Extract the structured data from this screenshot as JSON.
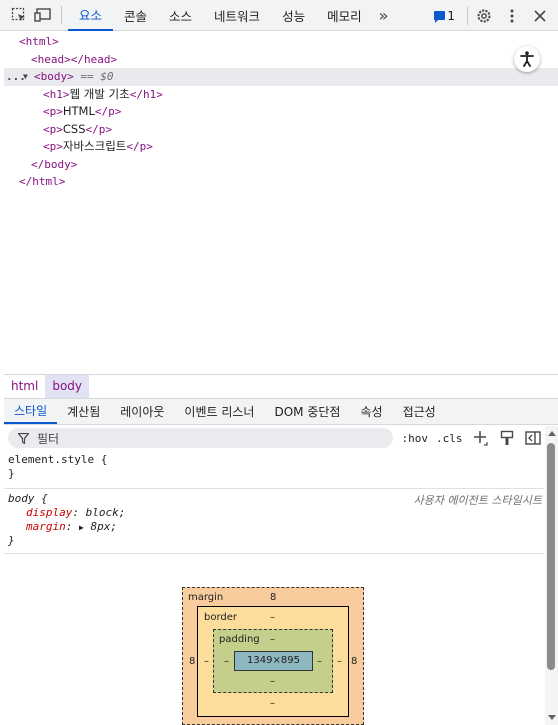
{
  "toolbar": {
    "tabs": [
      "요소",
      "콘솔",
      "소스",
      "네트워크",
      "성능",
      "메모리"
    ],
    "more": "»",
    "issues_count": "1"
  },
  "dom": {
    "lines": [
      {
        "open": "<html>"
      },
      {
        "open": "<head></head>"
      },
      {
        "open": "<body>",
        "eq": " == $0"
      },
      {
        "open": "<h1>",
        "text": "웹 개발 기초",
        "close": "</h1>"
      },
      {
        "open": "<p>",
        "text": "HTML",
        "close": "</p>"
      },
      {
        "open": "<p>",
        "text": "CSS",
        "close": "</p>"
      },
      {
        "open": "<p>",
        "text": "자바스크립트",
        "close": "</p>"
      },
      {
        "open": "</body>"
      },
      {
        "open": "</html>"
      }
    ],
    "dots": "..."
  },
  "breadcrumb": [
    "html",
    "body"
  ],
  "styles_tabs": [
    "스타일",
    "계산됨",
    "레이아웃",
    "이벤트 리스너",
    "DOM 중단점",
    "속성",
    "접근성"
  ],
  "filter": {
    "placeholder": "필터",
    "hov": ":hov",
    "cls": ".cls"
  },
  "rules": {
    "element_style": {
      "selector": "element.style {",
      "close": "}"
    },
    "body": {
      "selector": "body {",
      "source": "사용자 에이전트 스타일시트",
      "p1_name": "display",
      "p1_value": "block;",
      "p2_name": "margin",
      "p2_value": "8px;",
      "close": "}"
    }
  },
  "box_model": {
    "margin_label": "margin",
    "margin_top": "8",
    "margin_left": "8",
    "margin_right": "8",
    "border_label": "border",
    "border_top": "–",
    "border_bottom": "–",
    "border_left": "–",
    "border_right": "–",
    "padding_label": "padding",
    "padding_top": "–",
    "padding_bottom": "–",
    "padding_left": "–",
    "padding_right": "–",
    "content": "1349×895"
  },
  "colors": {
    "accent": "#0b57d0",
    "tag": "#881280",
    "prop": "#c80000"
  }
}
